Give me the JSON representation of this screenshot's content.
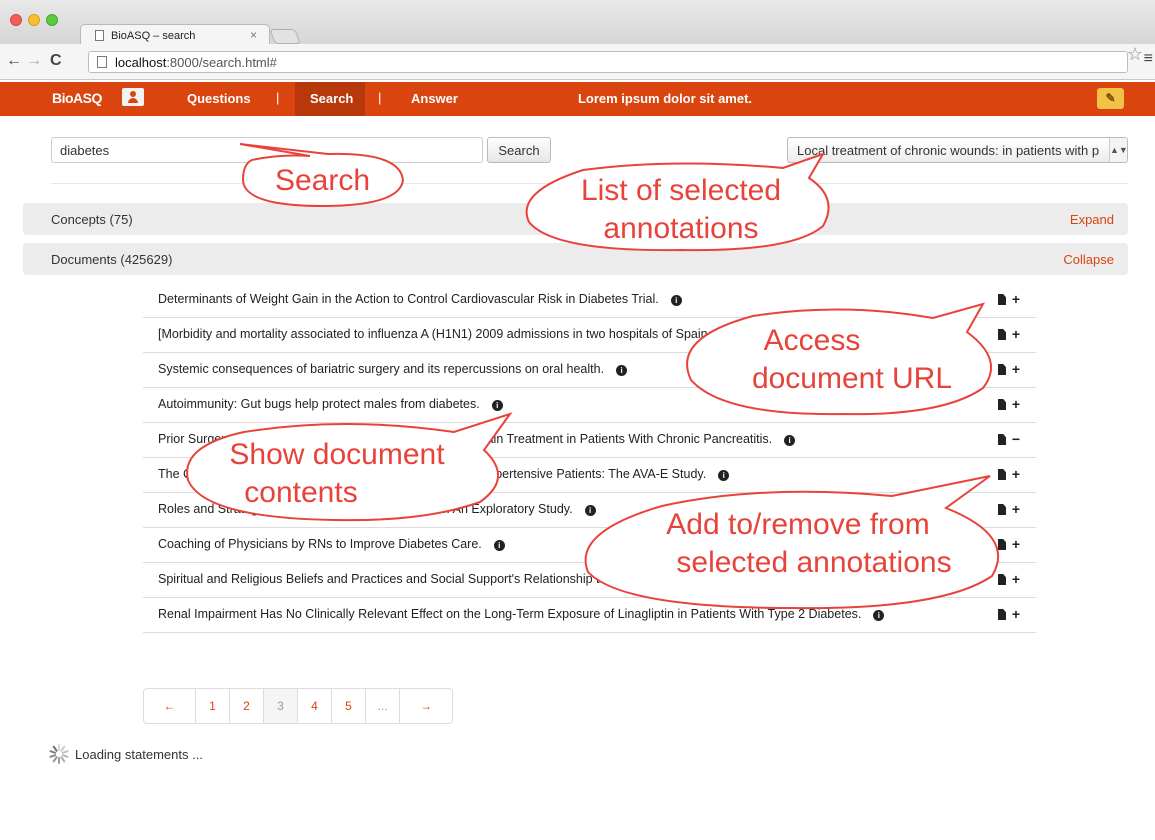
{
  "browser": {
    "tab_title": "BioASQ – search",
    "tab_close": "×",
    "url_host": "localhost",
    "url_rest": ":8000/search.html#",
    "back": "←",
    "forward": "→",
    "reload": "C",
    "star": "☆",
    "menu": "≡"
  },
  "navbar": {
    "logo": "BioASQ",
    "items": [
      "Questions",
      "Search",
      "Answer"
    ],
    "separators": [
      "|",
      "|"
    ],
    "center_text": "Lorem ipsum dolor sit amet.",
    "edit_icon": "✎"
  },
  "search": {
    "value": "diabetes",
    "button": "Search",
    "selected_annotation": "Local treatment of chronic wounds: in patients with p",
    "select_arrow": "▲▼"
  },
  "sections": {
    "concepts": {
      "title": "Concepts (75)",
      "toggle": "Expand"
    },
    "documents": {
      "title": "Documents (425629)",
      "toggle": "Collapse"
    }
  },
  "documents": [
    {
      "title": "Determinants of Weight Gain in the Action to Control Cardiovascular Risk in Diabetes Trial.",
      "action": "+"
    },
    {
      "title": "[Morbidity and mortality associated to influenza A (H1N1) 2009 admissions in two hospitals of Spain and analysis of its economic impact].",
      "action": "+"
    },
    {
      "title": "Systemic consequences of bariatric surgery and its repercussions on oral health.",
      "action": "+"
    },
    {
      "title": "Autoimmunity: Gut bugs help protect males from diabetes.",
      "action": "+"
    },
    {
      "title": "Prior Surgery and Other Factors Associated With Chronic Pain Treatment in Patients With Chronic Pancreatitis.",
      "action": "−"
    },
    {
      "title": "The Clinical Evaluation of Anti-diabetic Vascular Effects in Hypertensive Patients: The AVA-E Study.",
      "action": "+"
    },
    {
      "title": "Roles and Strategies of Diabetes Care Coordinators: An Exploratory Study.",
      "action": "+"
    },
    {
      "title": "Coaching of Physicians by RNs to Improve Diabetes Care.",
      "action": "+"
    },
    {
      "title": "Spiritual and Religious Beliefs and Practices and Social Support's Relationship to Diabetes Self-care among African Americans.",
      "action": "+"
    },
    {
      "title": "Renal Impairment Has No Clinically Relevant Effect on the Long-Term Exposure of Linagliptin in Patients With Type 2 Diabetes.",
      "action": "+"
    }
  ],
  "info_icon": "i",
  "pagination": {
    "prev": "←",
    "pages": [
      "1",
      "2",
      "3",
      "4",
      "5",
      "..."
    ],
    "active_page": "3",
    "next": "→"
  },
  "loading_text": "Loading statements ...",
  "callouts": {
    "search": "Search",
    "annotations_1": "List of selected",
    "annotations_2": "annotations",
    "access_1": "Access",
    "access_2": "document URL",
    "show_1": "Show document",
    "show_2": "contents",
    "add_1": "Add to/remove from",
    "add_2": "selected annotations"
  },
  "colors": {
    "brand": "#d9440f",
    "brand_dark": "#b6380b",
    "callout": "#e8433a",
    "edit_button": "#f0c245"
  }
}
